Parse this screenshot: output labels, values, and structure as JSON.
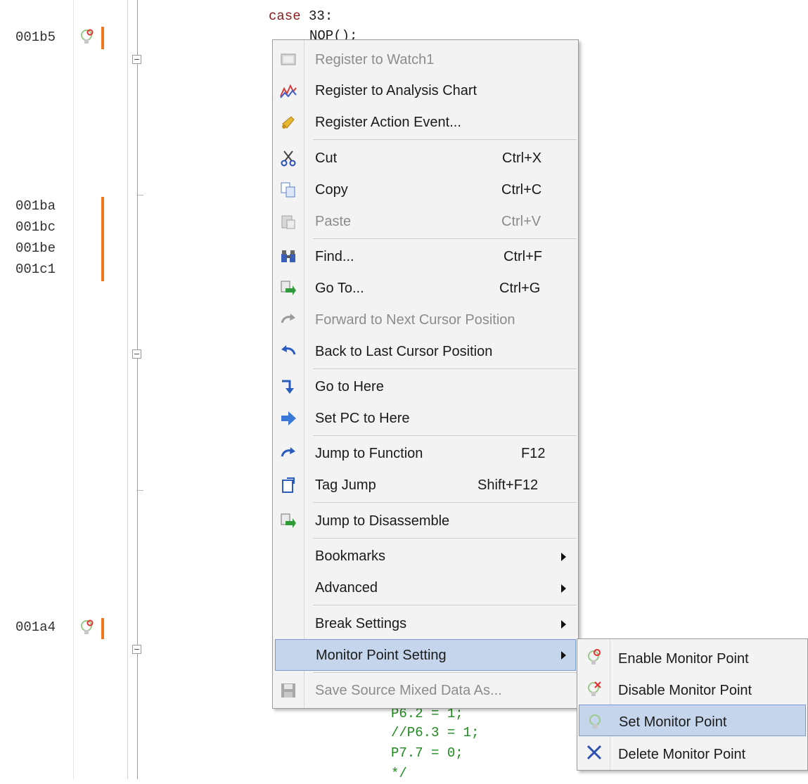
{
  "editor": {
    "addresses": [
      "001b5",
      "001ba",
      "001bc",
      "001be",
      "001c1",
      "001a4"
    ],
    "code_lines": {
      "case_keyword": "case",
      "case_value": " 33:",
      "nop": "NOP();",
      "p62": "P6.2 = 1;",
      "p63": "//P6.3 = 1;",
      "p77": "P7.7 = 0;",
      "comment_end": "*/"
    }
  },
  "context_menu": {
    "items": [
      {
        "label": "Register to Watch1",
        "shortcut": "",
        "icon": "watch-icon",
        "disabled": true
      },
      {
        "label": "Register to Analysis Chart",
        "shortcut": "",
        "icon": "chart-icon",
        "disabled": false
      },
      {
        "label": "Register Action Event...",
        "shortcut": "",
        "icon": "bell-icon",
        "disabled": false
      },
      {
        "label": "Cut",
        "shortcut": "Ctrl+X",
        "icon": "scissors-icon",
        "disabled": false
      },
      {
        "label": "Copy",
        "shortcut": "Ctrl+C",
        "icon": "copy-icon",
        "disabled": false
      },
      {
        "label": "Paste",
        "shortcut": "Ctrl+V",
        "icon": "paste-icon",
        "disabled": true
      },
      {
        "label": "Find...",
        "shortcut": "Ctrl+F",
        "icon": "binoculars-icon",
        "disabled": false
      },
      {
        "label": "Go To...",
        "shortcut": "Ctrl+G",
        "icon": "goto-icon",
        "disabled": false
      },
      {
        "label": "Forward to Next Cursor Position",
        "shortcut": "",
        "icon": "forward-icon",
        "disabled": true
      },
      {
        "label": "Back to Last Cursor Position",
        "shortcut": "",
        "icon": "back-icon",
        "disabled": false
      },
      {
        "label": "Go to Here",
        "shortcut": "",
        "icon": "go-here-icon",
        "disabled": false
      },
      {
        "label": "Set PC to Here",
        "shortcut": "",
        "icon": "set-pc-icon",
        "disabled": false
      },
      {
        "label": "Jump to Function",
        "shortcut": "F12",
        "icon": "jump-function-icon",
        "disabled": false
      },
      {
        "label": "Tag Jump",
        "shortcut": "Shift+F12",
        "icon": "tag-jump-icon",
        "disabled": false
      },
      {
        "label": "Jump to Disassemble",
        "shortcut": "",
        "icon": "disassemble-icon",
        "disabled": false
      },
      {
        "label": "Bookmarks",
        "shortcut": "",
        "icon": "",
        "disabled": false,
        "submenu": true
      },
      {
        "label": "Advanced",
        "shortcut": "",
        "icon": "",
        "disabled": false,
        "submenu": true
      },
      {
        "label": "Break Settings",
        "shortcut": "",
        "icon": "",
        "disabled": false,
        "submenu": true
      },
      {
        "label": "Monitor Point Setting",
        "shortcut": "",
        "icon": "",
        "disabled": false,
        "submenu": true,
        "highlighted": true
      },
      {
        "label": "Save Source Mixed Data As...",
        "shortcut": "",
        "icon": "save-icon",
        "disabled": true
      }
    ]
  },
  "submenu": {
    "items": [
      {
        "label": "Enable Monitor Point",
        "icon": "enable-monitor-point-icon"
      },
      {
        "label": "Disable Monitor Point",
        "icon": "disable-monitor-point-icon"
      },
      {
        "label": "Set Monitor Point",
        "icon": "set-monitor-point-icon",
        "highlighted": true
      },
      {
        "label": "Delete Monitor Point",
        "icon": "delete-icon"
      }
    ]
  },
  "colors": {
    "highlight": "#c5d5ec",
    "highlight_border": "#7b9ad3",
    "trace_bar": "#f07820",
    "keyword": "#8b1a1a",
    "comment_code": "#1f8a1f"
  }
}
